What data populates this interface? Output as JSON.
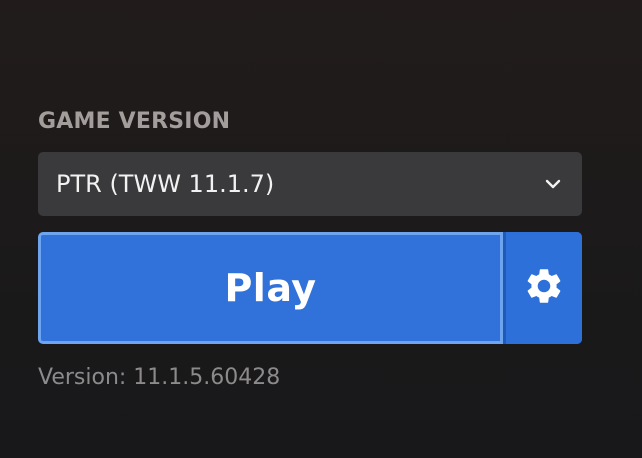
{
  "game_version": {
    "label": "GAME VERSION",
    "selected": "PTR (TWW 11.1.7)"
  },
  "actions": {
    "play_label": "Play",
    "settings_icon": "gear-icon"
  },
  "footer": {
    "version_text": "Version: 11.1.5.60428"
  },
  "colors": {
    "accent": "#3072da",
    "accent_border": "#6fa4ef",
    "select_bg": "#3a393b",
    "background": "#1c1a1a"
  }
}
